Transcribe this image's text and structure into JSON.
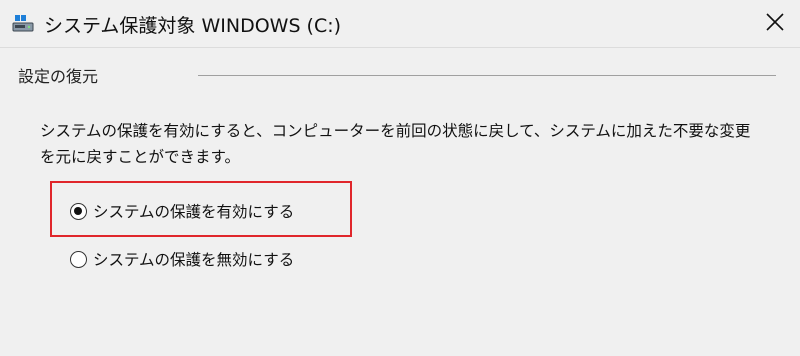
{
  "window": {
    "title": "システム保護対象 WINDOWS (C:)"
  },
  "group": {
    "title": "設定の復元"
  },
  "description": "システムの保護を有効にすると、コンピューターを前回の状態に戻して、システムに加えた不要な変更を元に戻すことができます。",
  "options": [
    {
      "label": "システムの保護を有効にする",
      "selected": true
    },
    {
      "label": "システムの保護を無効にする",
      "selected": false
    }
  ],
  "colors": {
    "highlight": "#e0262b",
    "background": "#f0f0f0"
  },
  "icons": {
    "title": "drive-icon",
    "close": "close-icon"
  }
}
